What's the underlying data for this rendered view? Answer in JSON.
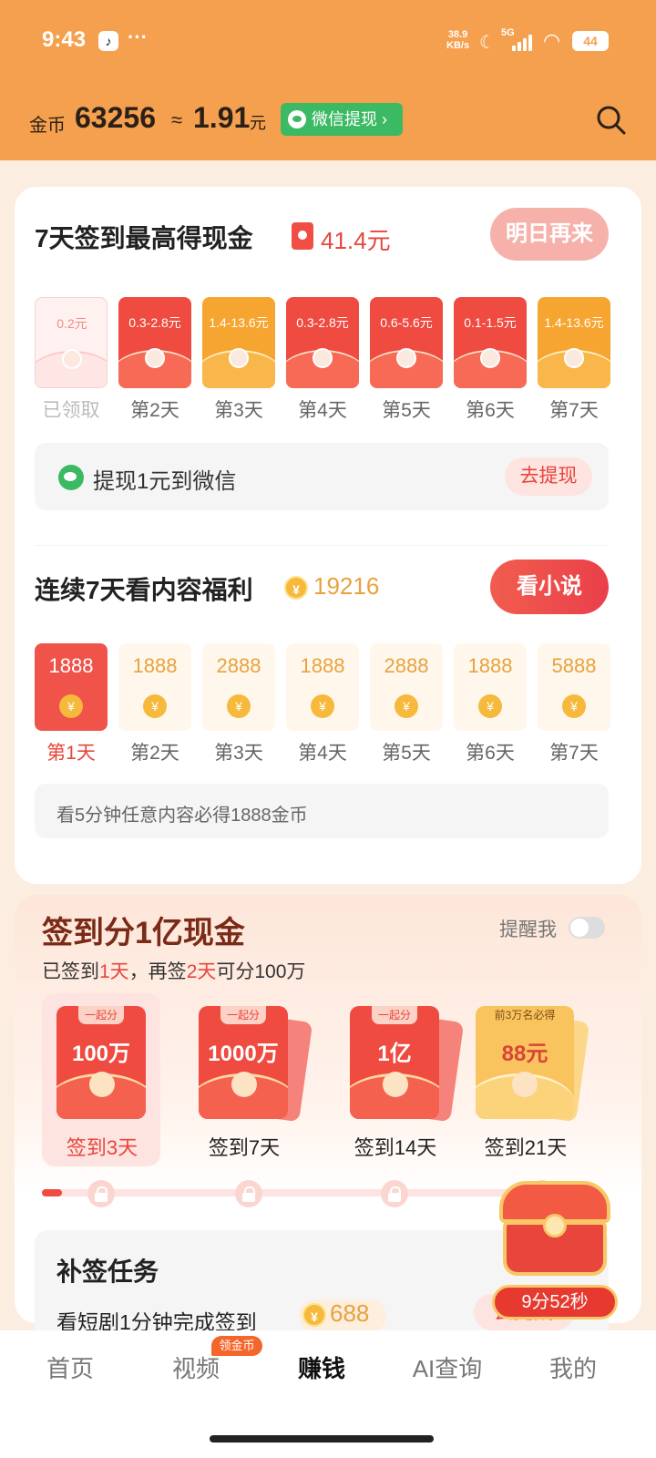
{
  "status_bar": {
    "time": "9:43",
    "app_icon": "tiktok-icon",
    "more": "···",
    "speed_top": "38.9",
    "speed_bottom": "KB/s",
    "network": "5G",
    "battery": "44"
  },
  "header": {
    "coin_label": "金币",
    "coin_value": "63256",
    "approx": "≈",
    "money": "1.91",
    "money_unit": "元",
    "wx_button": "微信提现",
    "wx_chevron": "›"
  },
  "checkin": {
    "title": "7天签到最高得现金",
    "amount": "41.4元",
    "button": "明日再来",
    "days": [
      {
        "amount": "0.2元",
        "label": "已领取",
        "style": "done"
      },
      {
        "amount": "0.3-2.8元",
        "label": "第2天",
        "style": "red"
      },
      {
        "amount": "1.4-13.6元",
        "label": "第3天",
        "style": "orange"
      },
      {
        "amount": "0.3-2.8元",
        "label": "第4天",
        "style": "red"
      },
      {
        "amount": "0.6-5.6元",
        "label": "第5天",
        "style": "red"
      },
      {
        "amount": "0.1-1.5元",
        "label": "第6天",
        "style": "red"
      },
      {
        "amount": "1.4-13.6元",
        "label": "第7天",
        "style": "orange"
      }
    ],
    "withdraw_text": "提现1元到微信",
    "withdraw_button": "去提现"
  },
  "watch": {
    "title": "连续7天看内容福利",
    "coins": "19216",
    "button": "看小说",
    "coin_symbol": "¥",
    "days": [
      {
        "coins": "1888",
        "label": "第1天",
        "active": true
      },
      {
        "coins": "1888",
        "label": "第2天",
        "active": false
      },
      {
        "coins": "2888",
        "label": "第3天",
        "active": false
      },
      {
        "coins": "1888",
        "label": "第4天",
        "active": false
      },
      {
        "coins": "2888",
        "label": "第5天",
        "active": false
      },
      {
        "coins": "1888",
        "label": "第6天",
        "active": false
      },
      {
        "coins": "5888",
        "label": "第7天",
        "active": false
      }
    ],
    "hint": "看5分钟任意内容必得1888金币"
  },
  "cash_event": {
    "title": "签到分1亿现金",
    "remind_label": "提醒我",
    "subtitle_part1": "已签到",
    "signed_days": "1天",
    "subtitle_part2": "，再签",
    "remaining_days": "2天",
    "subtitle_part3": "可分100万",
    "rewards": [
      {
        "tag": "一起分",
        "value": "100万",
        "label": "签到3天"
      },
      {
        "tag": "一起分",
        "value": "1000万",
        "label": "签到7天"
      },
      {
        "tag": "一起分",
        "value": "1亿",
        "label": "签到14天"
      },
      {
        "tag": "前3万名必得",
        "value": "88元",
        "label": "签到21天"
      }
    ],
    "progress_fraction": 0.04
  },
  "task": {
    "title": "补签任务",
    "item_text": "看短剧1分钟完成签到",
    "item_coins": "688",
    "item_button": "去完成",
    "timer": "9分52秒"
  },
  "bottom_nav": {
    "items": [
      "首页",
      "视频",
      "赚钱",
      "AI查询",
      "我的"
    ],
    "active_index": 2,
    "badge": "领金币"
  },
  "colors": {
    "header_orange": "#f4a04e",
    "red": "#ef4b41",
    "orange": "#f7a531",
    "wechat_green": "#3cb963"
  }
}
